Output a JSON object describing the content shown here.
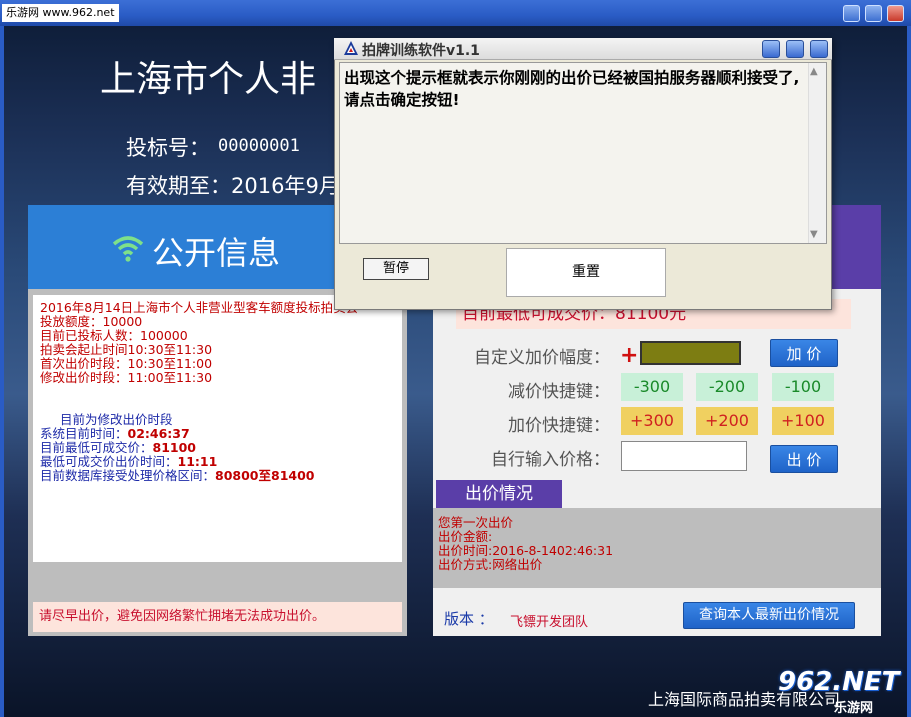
{
  "window": {
    "watermark": "乐游网 www.962.net"
  },
  "main": {
    "title": "上海市个人非",
    "bid_no_label": "投标号：",
    "bid_no_value": "00000001",
    "valid_until": "有效期至：2016年9月"
  },
  "public_info": {
    "title": "公开信息",
    "lines": [
      {
        "text": "2016年8月14日上海市个人非营业型客车额度投标拍卖会",
        "style": "red"
      },
      {
        "text": "投放额度：10000",
        "style": "red"
      },
      {
        "text": "目前已投标人数：100000",
        "style": "red"
      },
      {
        "text": "拍卖会起止时间10:30至11:30",
        "style": "red"
      },
      {
        "text": "首次出价时段：10:30至11:00",
        "style": "red"
      },
      {
        "text": "修改出价时段：11:00至11:30",
        "style": "red"
      }
    ],
    "current_phase": "目前为修改出价时段",
    "system_time_label": "系统目前时间：",
    "system_time_value": "02:46:37",
    "min_price_label": "目前最低可成交价：",
    "min_price_value": "81100",
    "min_price_time_label": "最低可成交价出价时间：",
    "min_price_time_value": "11:11",
    "range_label": "目前数据库接受处理价格区间：",
    "range_value": "80800至81400",
    "warning": "请尽早出价，避免因网络繁忙拥堵无法成功出价。"
  },
  "right_panel": {
    "min_price_text": "目前最低可成交价：81100元",
    "custom_increase_label": "自定义加价幅度：",
    "plus_sign": "+",
    "add_price_button": "加 价",
    "decrease_label": "减价快捷键：",
    "decrease_values": [
      "-300",
      "-200",
      "-100"
    ],
    "increase_label": "加价快捷键：",
    "increase_values": [
      "+300",
      "+200",
      "+100"
    ],
    "manual_price_label": "自行输入价格：",
    "bid_button": "出 价",
    "bid_status_tab": "出价情况",
    "bid_status_lines": [
      "您第一次出价",
      "出价金额:",
      "出价时间:2016-8-1402:46:31",
      "出价方式:网络出价"
    ],
    "version_label": "版本 ：",
    "version_value": "飞镖开发团队",
    "query_button": "查询本人最新出价情况"
  },
  "footer": {
    "text": "上海国际商品拍卖有限公司",
    "logo_text": "962.NET",
    "logo_sub": "乐游网"
  },
  "dialog": {
    "title": "拍牌训练软件v1.1",
    "message": "出现这个提示框就表示你刚刚的出价已经被国拍服务器顺利接受了,请点击确定按钮!",
    "pause_button": "暂停",
    "reset_button": "重置"
  },
  "colors": {
    "public_header": "#2c7fd6",
    "right_header": "#5a3ea8",
    "price_red": "#c8102e",
    "button_blue": "#1f63c8"
  }
}
